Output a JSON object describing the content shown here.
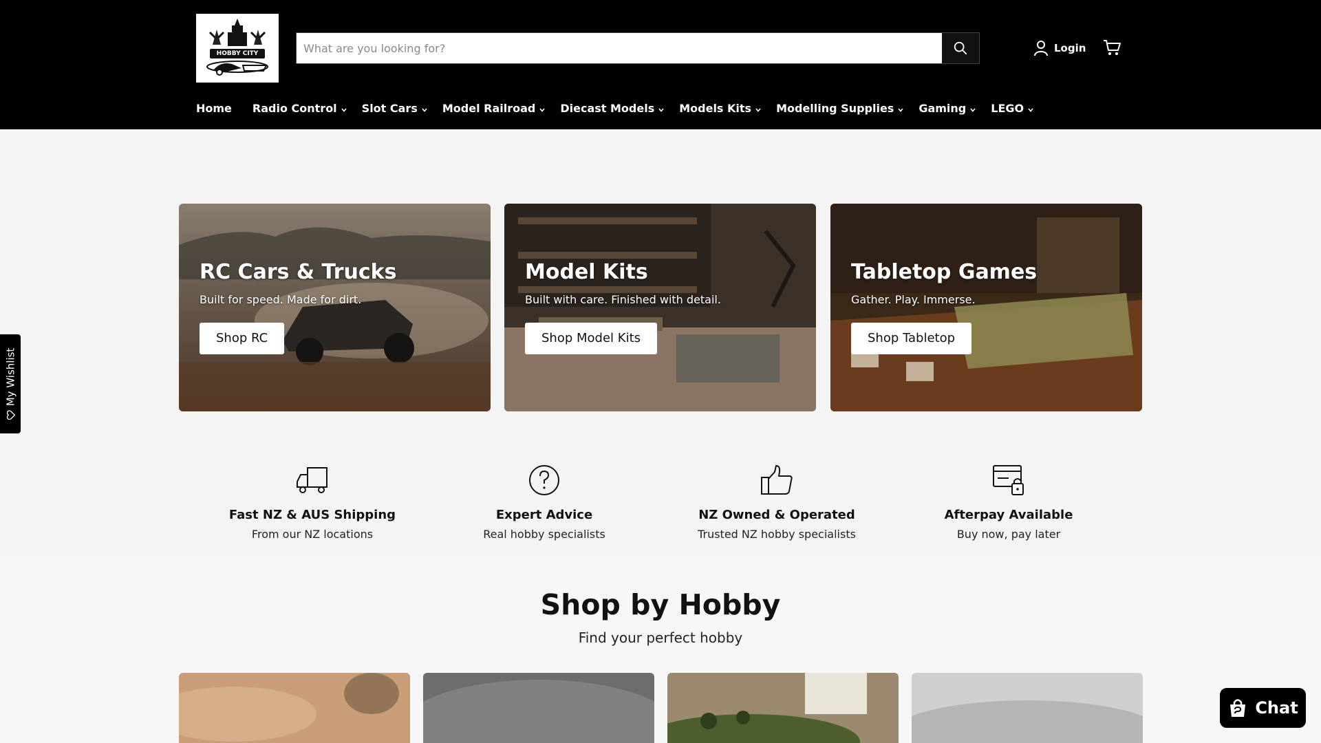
{
  "header": {
    "logo_text": "HOBBY CITY",
    "search_placeholder": "What are you looking for?",
    "login_label": "Login"
  },
  "nav": [
    {
      "label": "Home",
      "dropdown": false
    },
    {
      "label": "Radio Control",
      "dropdown": true
    },
    {
      "label": "Slot Cars",
      "dropdown": true
    },
    {
      "label": "Model Railroad",
      "dropdown": true
    },
    {
      "label": "Diecast Models",
      "dropdown": true
    },
    {
      "label": "Models Kits",
      "dropdown": true
    },
    {
      "label": "Modelling Supplies",
      "dropdown": true
    },
    {
      "label": "Gaming",
      "dropdown": true
    },
    {
      "label": "LEGO",
      "dropdown": true
    }
  ],
  "promos": [
    {
      "title": "RC Cars & Trucks",
      "subtitle": "Built for speed. Made for dirt.",
      "button": "Shop RC"
    },
    {
      "title": "Model Kits",
      "subtitle": "Built with care. Finished with detail.",
      "button": "Shop Model Kits"
    },
    {
      "title": "Tabletop Games",
      "subtitle": "Gather. Play. Immerse.",
      "button": "Shop Tabletop"
    }
  ],
  "features": [
    {
      "icon": "truck-icon",
      "title": "Fast NZ & AUS Shipping",
      "subtitle": "From our NZ locations"
    },
    {
      "icon": "question-icon",
      "title": "Expert Advice",
      "subtitle": "Real hobby specialists"
    },
    {
      "icon": "thumbs-up-icon",
      "title": "NZ Owned & Operated",
      "subtitle": "Trusted NZ hobby specialists"
    },
    {
      "icon": "card-lock-icon",
      "title": "Afterpay Available",
      "subtitle": "Buy now, pay later"
    }
  ],
  "shop_by_hobby": {
    "title": "Shop by Hobby",
    "subtitle": "Find your perfect hobby"
  },
  "wishlist_label": "My Wishlist",
  "chat_label": "Chat",
  "colors": {
    "header_bg": "#000000",
    "page_bg": "#f4f4f4",
    "accent": "#ffffff"
  }
}
